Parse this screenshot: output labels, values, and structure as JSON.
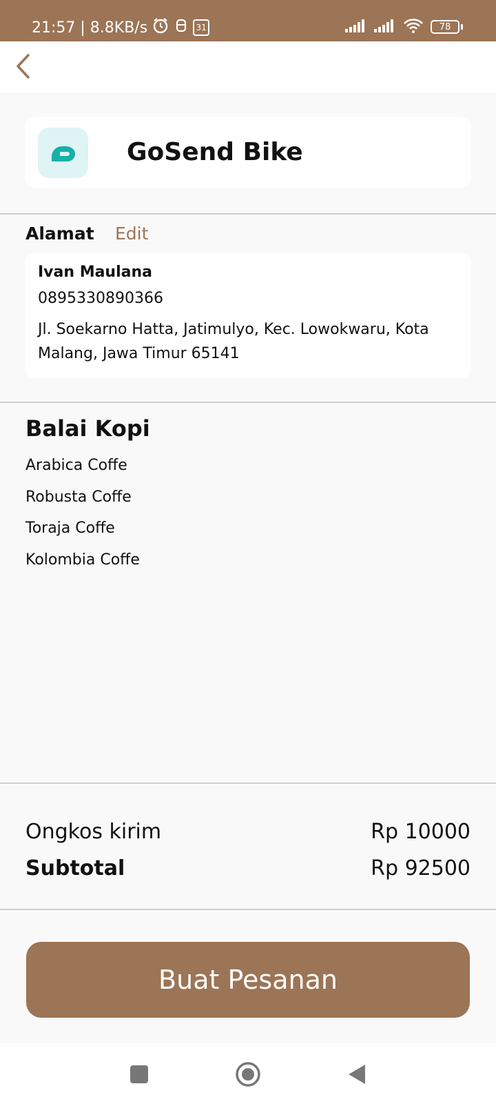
{
  "status_bar": {
    "time_speed": "21:57 | 8.8KB/s",
    "calendar_day": "31",
    "battery": "78",
    "icons": [
      "alarm-icon",
      "shield-icon",
      "calendar-icon",
      "signal-icon",
      "signal-icon",
      "wifi-icon",
      "battery-icon"
    ]
  },
  "header": {
    "back_icon": "chevron-left-icon"
  },
  "service": {
    "name": "GoSend Bike",
    "logo_icon": "gosend-logo-icon",
    "logo_bg": "#dff4f4",
    "logo_color": "#17b0a8"
  },
  "address": {
    "title": "Alamat",
    "edit_label": "Edit",
    "name": "Ivan Maulana",
    "phone": "0895330890366",
    "line": "Jl. Soekarno Hatta, Jatimulyo, Kec. Lowokwaru, Kota Malang, Jawa Timur 65141"
  },
  "shop": {
    "name": "Balai Kopi",
    "items": [
      "Arabica Coffe",
      "Robusta Coffe",
      "Toraja Coffe",
      "Kolombia Coffe"
    ]
  },
  "summary": {
    "shipping_label": "Ongkos kirim",
    "shipping_value": "Rp 10000",
    "subtotal_label": "Subtotal",
    "subtotal_value": "Rp 92500"
  },
  "order_button": {
    "label": "Buat Pesanan"
  },
  "nav_bar": {
    "icons": [
      "recents-icon",
      "home-icon",
      "back-icon"
    ]
  },
  "colors": {
    "accent": "#9c7456",
    "background": "#f9f9f9",
    "card": "#ffffff"
  }
}
